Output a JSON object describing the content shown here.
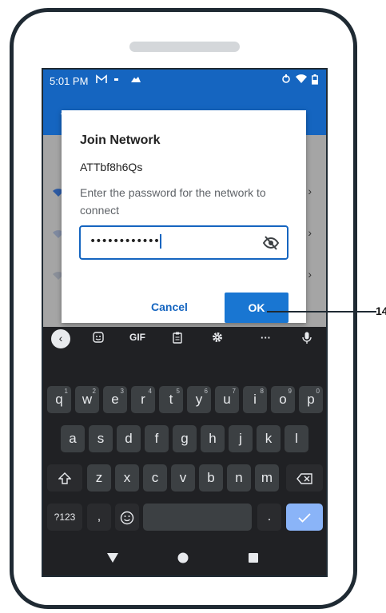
{
  "status_bar": {
    "time": "5:01 PM",
    "icons": [
      "gmail-icon",
      "dot-icon",
      "cloud-icon",
      "sync-icon",
      "wifi-icon",
      "battery-icon"
    ]
  },
  "dialog": {
    "title": "Join Network",
    "ssid": "ATTbf8h6Qs",
    "message": "Enter the password for the network to connect",
    "password_masked": "••••••••••••",
    "cancel_label": "Cancel",
    "ok_label": "OK"
  },
  "callout": {
    "label": "14"
  },
  "keyboard": {
    "toolbar": {
      "gif_label": "GIF",
      "more_label": "···"
    },
    "row1": [
      "q",
      "w",
      "e",
      "r",
      "t",
      "y",
      "u",
      "i",
      "o",
      "p"
    ],
    "row1_hints": [
      "1",
      "2",
      "3",
      "4",
      "5",
      "6",
      "7",
      "8",
      "9",
      "0"
    ],
    "row2": [
      "a",
      "s",
      "d",
      "f",
      "g",
      "h",
      "j",
      "k",
      "l"
    ],
    "row3": [
      "z",
      "x",
      "c",
      "v",
      "b",
      "n",
      "m"
    ],
    "symbols_label": "?123",
    "comma": ",",
    "period": "."
  },
  "colors": {
    "accent": "#1565c0",
    "ok_button": "#1976d2",
    "keyboard_bg": "#202124",
    "key_bg": "#3c4043",
    "enter_key": "#8ab4f8"
  }
}
